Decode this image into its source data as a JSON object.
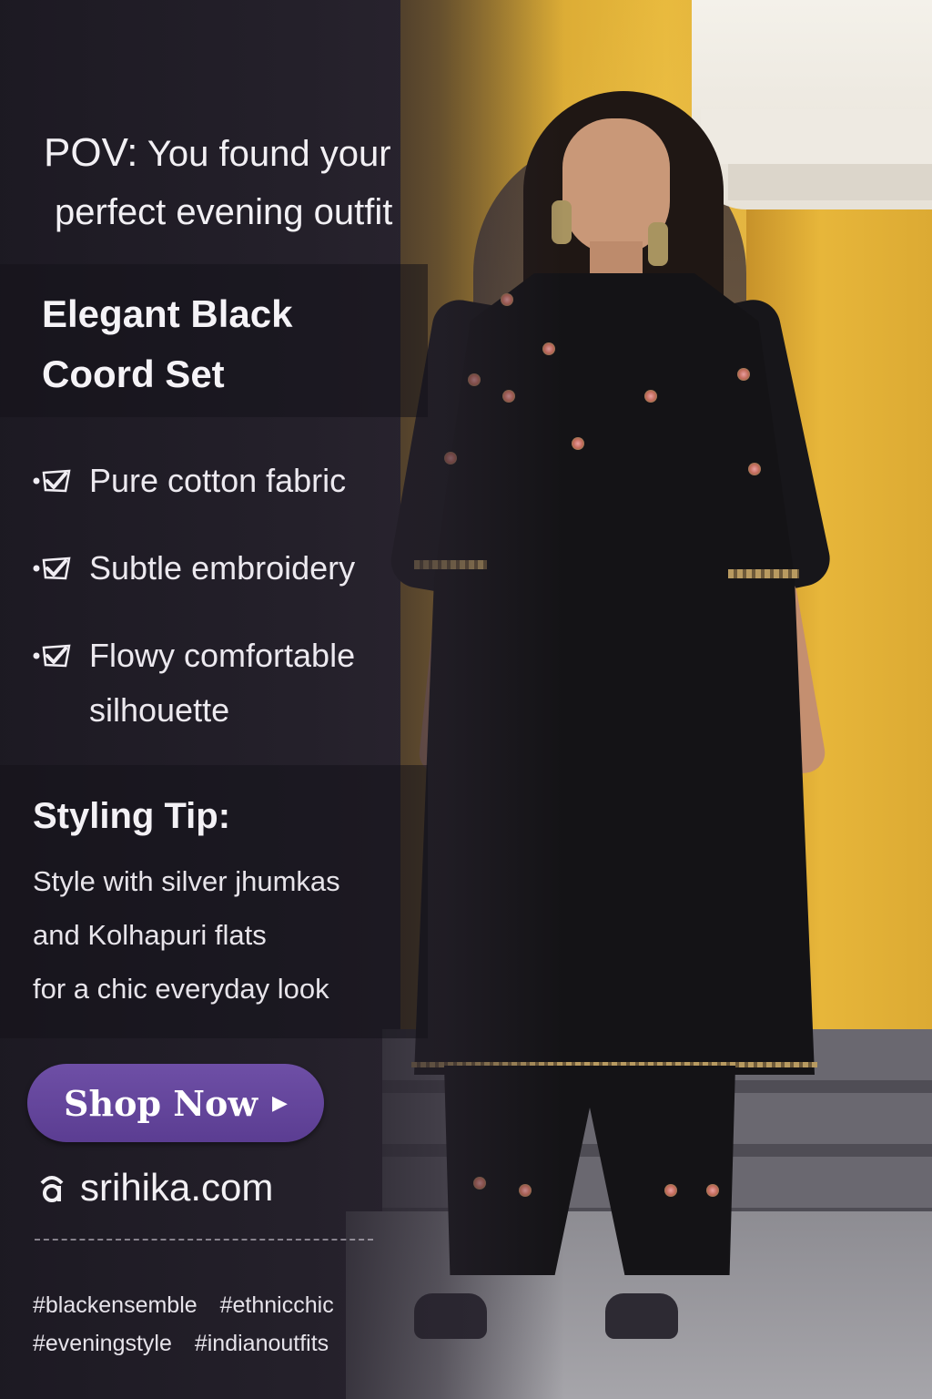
{
  "headline": {
    "pov_prefix": "POV:",
    "pov_line1": "You found your",
    "pov_line2": "perfect evening outfit"
  },
  "product": {
    "title_line1": "Elegant Black",
    "title_line2": "Coord Set"
  },
  "features": [
    {
      "icon": "check-icon",
      "text": "Pure cotton fabric"
    },
    {
      "icon": "check-icon",
      "text": "Subtle embroidery"
    },
    {
      "icon": "check-icon",
      "line1": "Flowy comfortable",
      "line2": "silhouette"
    }
  ],
  "styling_tip": {
    "title": "Styling Tip:",
    "lines": [
      "Style with silver jhumkas",
      "and Kolhapuri flats",
      "for a chic everyday look"
    ]
  },
  "cta": {
    "label": "Shop Now",
    "icon": "chevron-right-icon"
  },
  "website": {
    "icon": "globe-icon",
    "url": "srihika.com"
  },
  "hashtags": [
    "#blackensemble",
    "#ethnicchic",
    "#eveningstyle",
    "#indianoutfits"
  ],
  "colors": {
    "overlay": "#1c1922",
    "button": "#5b3d92",
    "wall": "#e8b93c",
    "text": "#f2f0f4"
  }
}
